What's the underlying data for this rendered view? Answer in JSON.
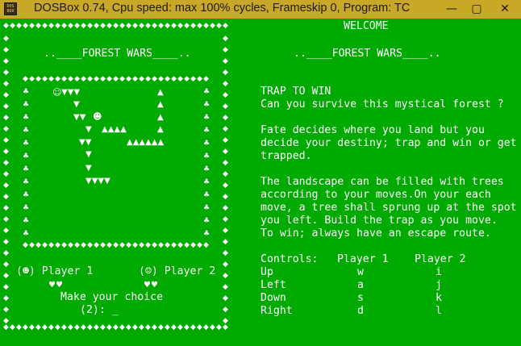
{
  "window": {
    "title": "DOSBox 0.74, Cpu speed: max 100% cycles, Frameskip  0, Program:      TC",
    "icon_label": "DOS BOX",
    "controls": {
      "minimize": "—",
      "maximize": "▢",
      "close": "✕"
    }
  },
  "left_panel": {
    "title": "..____FOREST WARS____..",
    "border_symbol": "◆",
    "field_border_symbol": "♣",
    "field_top_symbol": "◆",
    "player1_label": "(☻) Player 1",
    "player2_label": "(☺) Player 2",
    "player1_lives": "♥♥",
    "player2_lives": "♥♥",
    "prompt": "Make your choice",
    "input_line": "(2): _"
  },
  "game_board": {
    "player1_symbol": "☺",
    "player2_symbol": "☻",
    "tree_up": "▲",
    "tree_down": "▼",
    "trees": [
      {
        "row": 1,
        "text": "▼▼▼"
      },
      {
        "row": 1,
        "text": "▲"
      },
      {
        "row": 2,
        "text": "▼"
      },
      {
        "row": 2,
        "text": "▲"
      },
      {
        "row": 3,
        "text": "▼▼"
      },
      {
        "row": 3,
        "text": "▲"
      },
      {
        "row": 4,
        "text": "▼"
      },
      {
        "row": 4,
        "text": "▲▲▲▲"
      },
      {
        "row": 4,
        "text": "▲"
      },
      {
        "row": 5,
        "text": "▼▼"
      },
      {
        "row": 5,
        "text": "▲▲▲▲▲▲"
      },
      {
        "row": 6,
        "text": "▼"
      },
      {
        "row": 7,
        "text": "▼"
      },
      {
        "row": 8,
        "text": "▼▼▼▼"
      }
    ]
  },
  "right_panel": {
    "welcome": "WELCOME",
    "title": "..____FOREST WARS____..",
    "heading": "TRAP TO WIN",
    "intro": "Can you survive this mystical forest ?",
    "para1": [
      "Fate decides where you land but you",
      "decide your destiny; trap and win or get",
      "trapped."
    ],
    "para2": [
      "The landscape can be filled with trees",
      "according to your moves.On your each",
      "move, a tree shall sprung up at the spot",
      "you left. Build the trap as you move.",
      "To win; always have an escape route."
    ],
    "controls_header": {
      "label": "Controls:",
      "p1": "Player 1",
      "p2": "Player 2"
    },
    "controls": [
      {
        "action": "Up",
        "p1": "w",
        "p2": "i"
      },
      {
        "action": "Left",
        "p1": "a",
        "p2": "j"
      },
      {
        "action": "Down",
        "p1": "s",
        "p2": "k"
      },
      {
        "action": "Right",
        "p1": "d",
        "p2": "l"
      }
    ]
  },
  "colors": {
    "screen_bg": "#00aa00",
    "text": "#ffffff",
    "titlebar_bg": "#c9a827"
  }
}
